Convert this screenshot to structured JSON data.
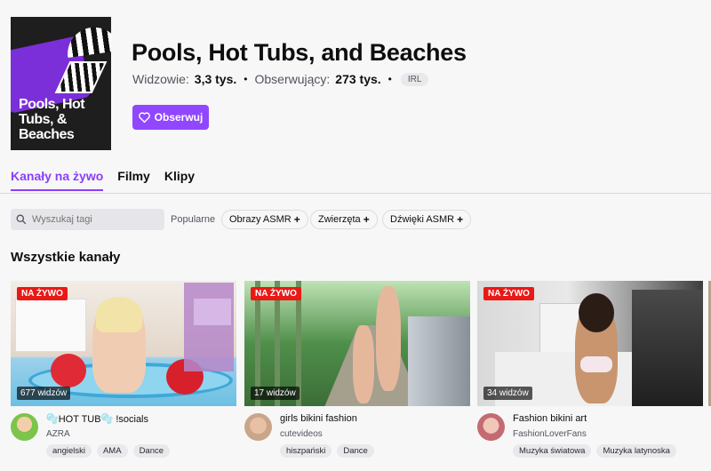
{
  "category": {
    "title": "Pools, Hot Tubs, and Beaches",
    "box_art_text": "Pools, Hot Tubs, & Beaches",
    "viewers_label": "Widzowie:",
    "viewers_value": "3,3 tys.",
    "followers_label": "Obserwujący:",
    "followers_value": "273 tys.",
    "tag": "IRL",
    "follow_label": "Obserwuj",
    "accent_color": "#9147ff"
  },
  "tabs": [
    {
      "label": "Kanały na żywo",
      "active": true
    },
    {
      "label": "Filmy",
      "active": false
    },
    {
      "label": "Klipy",
      "active": false
    }
  ],
  "filters": {
    "search_placeholder": "Wyszukaj tagi",
    "popular_label": "Popularne",
    "tags": [
      "Obrazy ASMR",
      "Zwierzęta",
      "Dźwięki ASMR"
    ]
  },
  "section_title": "Wszystkie kanały",
  "streams": [
    {
      "live_label": "NA ŻYWO",
      "viewers": "677 widzów",
      "title": "🫧HOT TUB🫧 !socials",
      "channel": "AZRA",
      "tags": [
        "angielski",
        "AMA",
        "Dance"
      ]
    },
    {
      "live_label": "NA ŻYWO",
      "viewers": "17 widzów",
      "title": "girls bikini fashion",
      "channel": "cutevideos",
      "tags": [
        "hiszpański",
        "Dance"
      ]
    },
    {
      "live_label": "NA ŻYWO",
      "viewers": "34 widzów",
      "title": "Fashion bikini art",
      "channel": "FashionLoverFans",
      "tags": [
        "Muzyka światowa",
        "Muzyka latynoska"
      ]
    }
  ],
  "colors": {
    "live_badge": "#e91916",
    "active_tab": "#8a3ffc"
  }
}
